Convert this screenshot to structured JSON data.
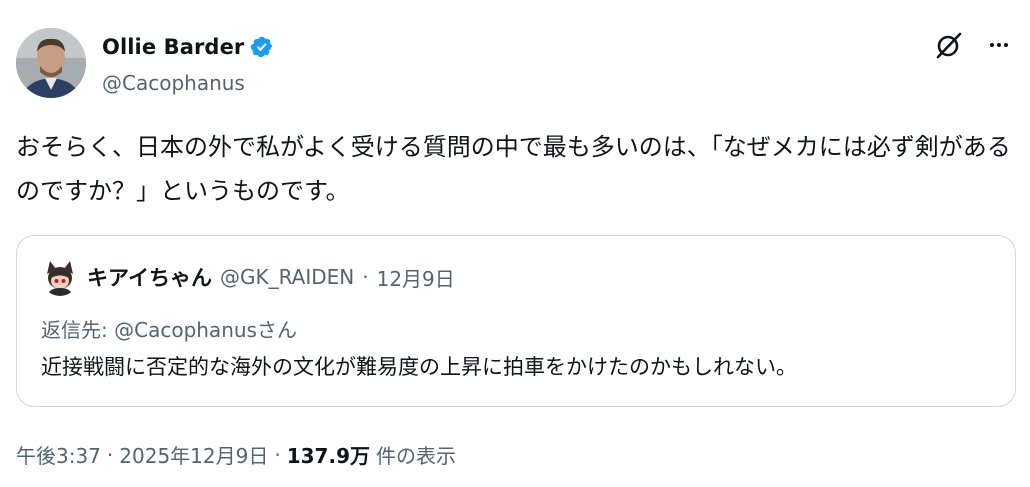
{
  "author": {
    "name": "Ollie Barder",
    "handle": "@Cacophanus",
    "verified": true,
    "verified_color": "#1d9bf0"
  },
  "tweet": {
    "text": "おそらく、日本の外で私がよく受ける質問の中で最も多いのは、「なぜメカには必ず剣があるのですか？」というものです。"
  },
  "quote": {
    "name": "キアイちゃん",
    "handle": "@GK_RAIDEN",
    "sep": "·",
    "date": "12月9日",
    "reply_prefix": "返信先:",
    "reply_mention": "@Cacophanus",
    "reply_suffix": "さん",
    "text": "近接戦闘に否定的な海外の文化が難易度の上昇に拍車をかけたのかもしれない。"
  },
  "meta": {
    "time": "午後3:37",
    "sep": "·",
    "date": "2025年12月9日",
    "views": "137.9万",
    "views_label": "件の表示"
  },
  "icons": {
    "grok": "grok-icon",
    "more": "more-icon",
    "verified": "verified-badge-icon"
  }
}
